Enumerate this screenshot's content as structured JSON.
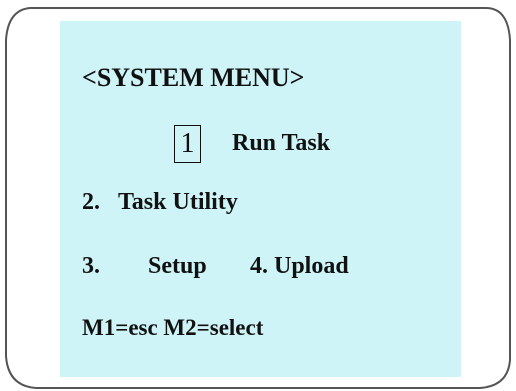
{
  "menu": {
    "title": "<SYSTEM MENU>",
    "cursor_value": "1",
    "items": [
      {
        "number": "",
        "label": "Run Task"
      },
      {
        "number": "2.",
        "label": "Task Utility"
      },
      {
        "number": "3.",
        "label": "Setup"
      },
      {
        "number": "",
        "label": "4. Upload"
      }
    ],
    "footer": "M1=esc M2=select"
  },
  "colors": {
    "screen_background": "#cef4f8",
    "text": "#111111",
    "frame": "#555555"
  }
}
